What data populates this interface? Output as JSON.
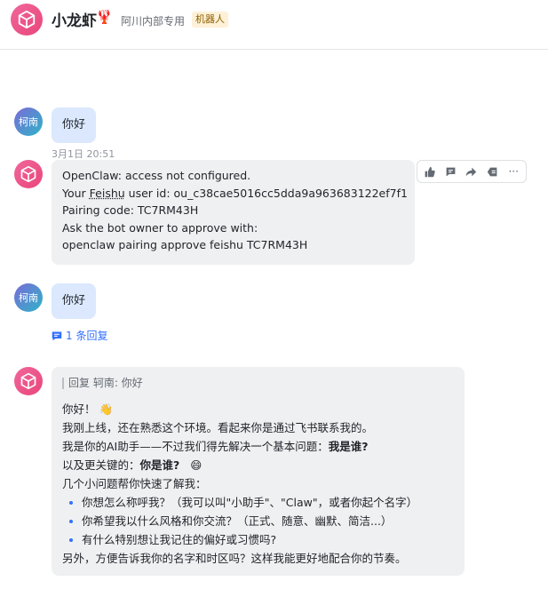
{
  "header": {
    "title": "小龙虾",
    "title_icon": "lobster-icon",
    "subtitle": "阿川内部专用",
    "badge": "机器人"
  },
  "messages": {
    "m1": {
      "avatar_text": "柯南",
      "text": "你好",
      "timestamp": "3月1日 20:51"
    },
    "m2": {
      "lines": [
        "OpenClaw: access not configured.",
        "Pairing code: TC7RM43H",
        "Ask the bot owner to approve with:",
        "openclaw pairing approve feishu TC7RM43H"
      ],
      "userid_prefix": "Your ",
      "userid_link": "Feishu",
      "userid_suffix": " user id: ou_c38cae5016cc5dda9a963683122ef7f1"
    },
    "m3": {
      "avatar_text": "柯南",
      "text": "你好",
      "reply_count": "1 条回复"
    },
    "m4": {
      "quote": "回复 轲南: 你好",
      "greeting": "你好！",
      "line1": "我刚上线，还在熟悉这个环境。看起来你是通过飞书联系我的。",
      "line2_prefix": "我是你的AI助手——不过我们得先解决一个基本问题：",
      "line2_bold": "我是谁?",
      "line3_prefix": "以及更关键的：",
      "line3_bold": "你是谁?",
      "line4": "几个小问题帮你快速了解我：",
      "bullets": [
        "你想怎么称呼我？（我可以叫\"小助手\"、\"Claw\"，或者你起个名字）",
        "你希望我以什么风格和你交流？（正式、随意、幽默、简洁...）",
        "有什么特别想让我记住的偏好或习惯吗?"
      ],
      "closing": "另外，方便告诉我你的名字和时区吗？这样我能更好地配合你的节奏。"
    }
  },
  "toolbar": {
    "buttons": [
      "thumbs-up-icon",
      "comment-icon",
      "forward-icon",
      "reply-icon",
      "more-icon"
    ],
    "more_label": "···"
  },
  "colors": {
    "bot_avatar": "#e9467a",
    "user_bubble": "#dbe8fd",
    "bot_bubble": "#eff0f1",
    "link": "#3370ff"
  }
}
